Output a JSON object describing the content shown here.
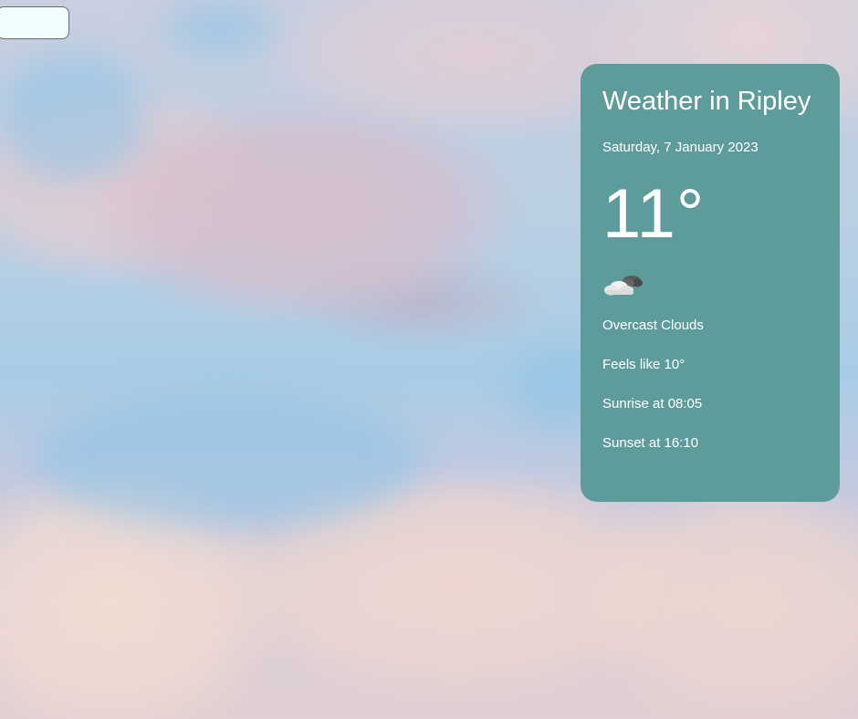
{
  "search": {
    "value": "",
    "placeholder": ""
  },
  "weather": {
    "title": "Weather in Ripley",
    "date": "Saturday, 7 January 2023",
    "temperature": "11°",
    "icon": "overcast-cloud-icon",
    "description": "Overcast Clouds",
    "feels_like": "Feels like 10°",
    "sunrise": "Sunrise at 08:05",
    "sunset": "Sunset at 16:10"
  },
  "colors": {
    "card_background": "#5e9c9c",
    "card_text": "#ffffff",
    "search_background": "#f1fdfd"
  }
}
